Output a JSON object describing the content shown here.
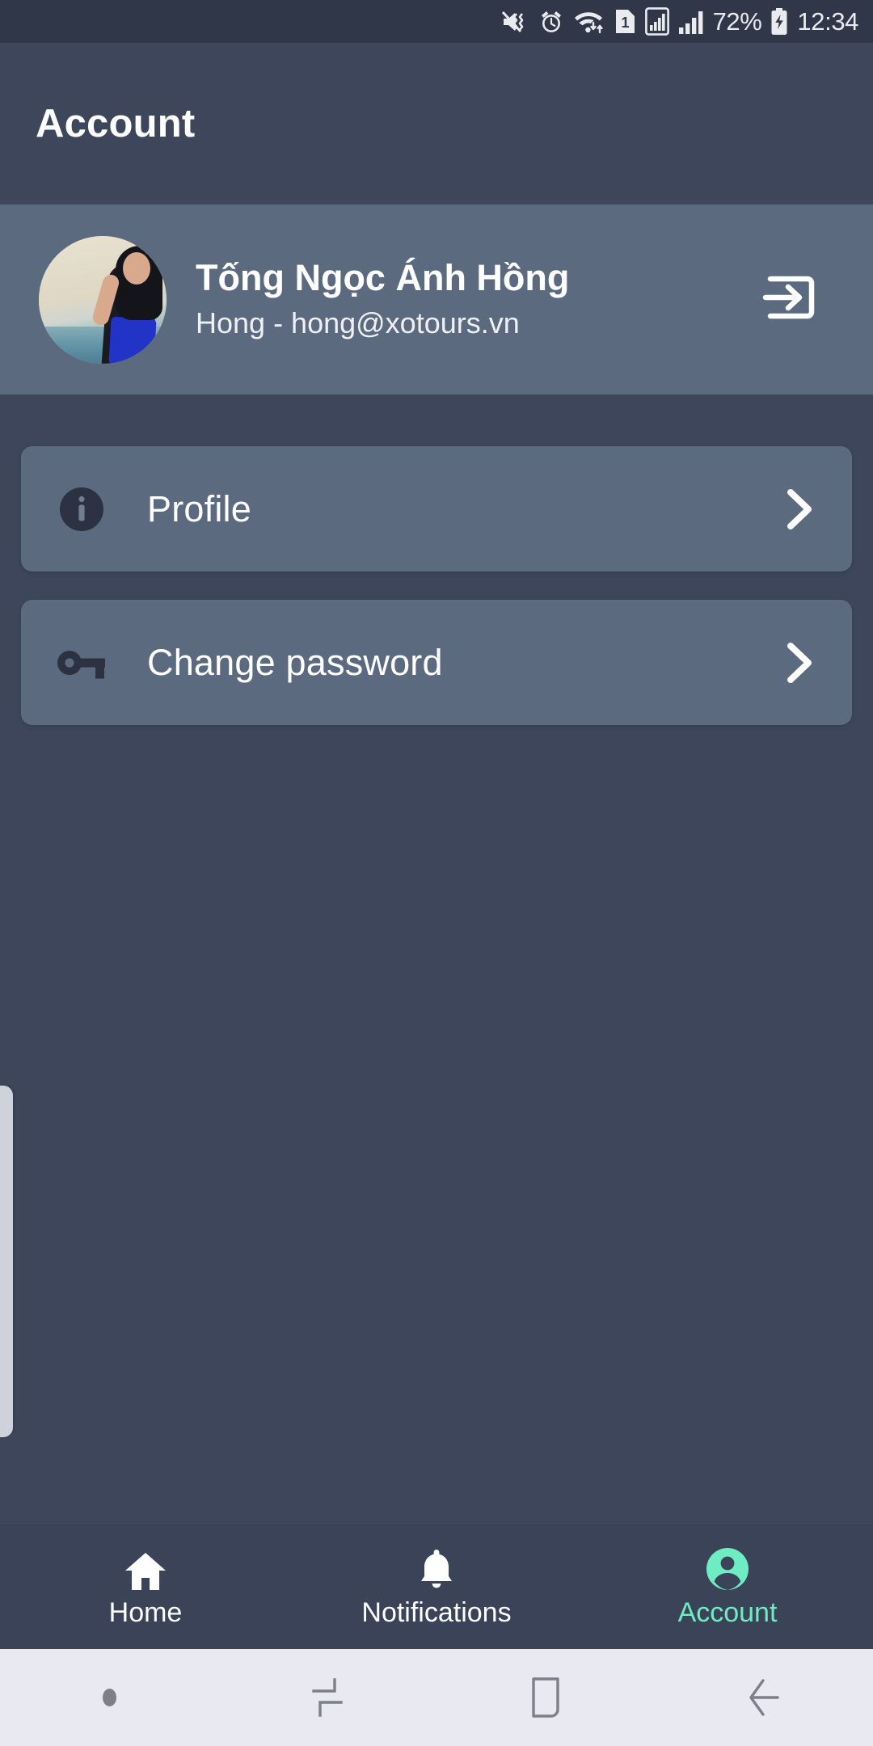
{
  "status_bar": {
    "battery_percent": "72%",
    "time": "12:34",
    "sim_label": "1",
    "icons": [
      "mute-vibrate-icon",
      "alarm-clock-icon",
      "wifi-data-transfer-icon",
      "sim-card-1-icon",
      "signal-boxed-icon",
      "signal-bars-icon",
      "battery-charging-icon"
    ],
    "background_color": "#2f3748"
  },
  "app_bar": {
    "title": "Account",
    "background_color": "#3d465b",
    "title_color": "#ffffff"
  },
  "profile": {
    "name": "Tống Ngọc Ánh Hồng",
    "subtitle": "Hong - hong@xotours.vn",
    "avatar_alt": "user-profile-photo",
    "logout_icon": "logout-icon",
    "background_color": "#5c6a80"
  },
  "menu": {
    "items": [
      {
        "label": "Profile",
        "icon": "info-circle-icon",
        "chevron": "chevron-right-icon"
      },
      {
        "label": "Change password",
        "icon": "key-icon",
        "chevron": "chevron-right-icon"
      }
    ],
    "card_color": "#5c6a80"
  },
  "bottom_nav": {
    "active_color": "#6fecc2",
    "inactive_color": "#ffffff",
    "background_color": "#3a4358",
    "items": [
      {
        "label": "Home",
        "icon": "home-icon",
        "active": false
      },
      {
        "label": "Notifications",
        "icon": "bell-icon",
        "active": false
      },
      {
        "label": "Account",
        "icon": "person-circle-icon",
        "active": true
      }
    ]
  },
  "system_nav": {
    "background_color": "#e9e9f1",
    "buttons": [
      "dot-indicator",
      "recents-icon",
      "home-square-icon",
      "back-arrow-icon"
    ]
  },
  "edge_handle": {
    "name": "edge-panel-handle",
    "color": "#cfd2da"
  }
}
